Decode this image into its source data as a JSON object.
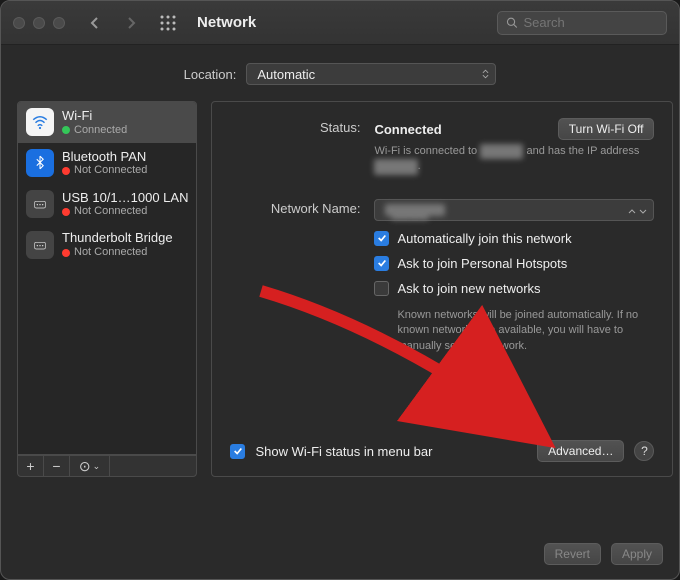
{
  "header": {
    "title": "Network",
    "search_placeholder": "Search"
  },
  "location": {
    "label": "Location:",
    "value": "Automatic"
  },
  "sidebar": {
    "items": [
      {
        "name": "Wi-Fi",
        "status": "Connected",
        "color": "green",
        "icon": "wifi"
      },
      {
        "name": "Bluetooth PAN",
        "status": "Not Connected",
        "color": "red",
        "icon": "bt"
      },
      {
        "name": "USB 10/1…1000 LAN",
        "status": "Not Connected",
        "color": "red",
        "icon": "eth"
      },
      {
        "name": "Thunderbolt Bridge",
        "status": "Not Connected",
        "color": "red",
        "icon": "eth"
      }
    ],
    "footer": {
      "add": "+",
      "remove": "−",
      "more": "⊙⌄"
    }
  },
  "detail": {
    "status_label": "Status:",
    "status_value": "Connected",
    "turn_off": "Turn Wi-Fi Off",
    "status_sub_prefix": "Wi-Fi is connected to ",
    "status_sub_redacted1": "████",
    "status_sub_mid": " and has the IP address ",
    "status_sub_redacted2": "████",
    "nn_label": "Network Name:",
    "nn_value_redacted": "████",
    "auto_join": "Automatically join this network",
    "ask_hotspots": "Ask to join Personal Hotspots",
    "ask_new": "Ask to join new networks",
    "ask_new_sub": "Known networks will be joined automatically. If no known networks are available, you will have to manually select a network.",
    "show_status": "Show Wi-Fi status in menu bar",
    "advanced": "Advanced…",
    "help": "?"
  },
  "actions": {
    "revert": "Revert",
    "apply": "Apply"
  }
}
